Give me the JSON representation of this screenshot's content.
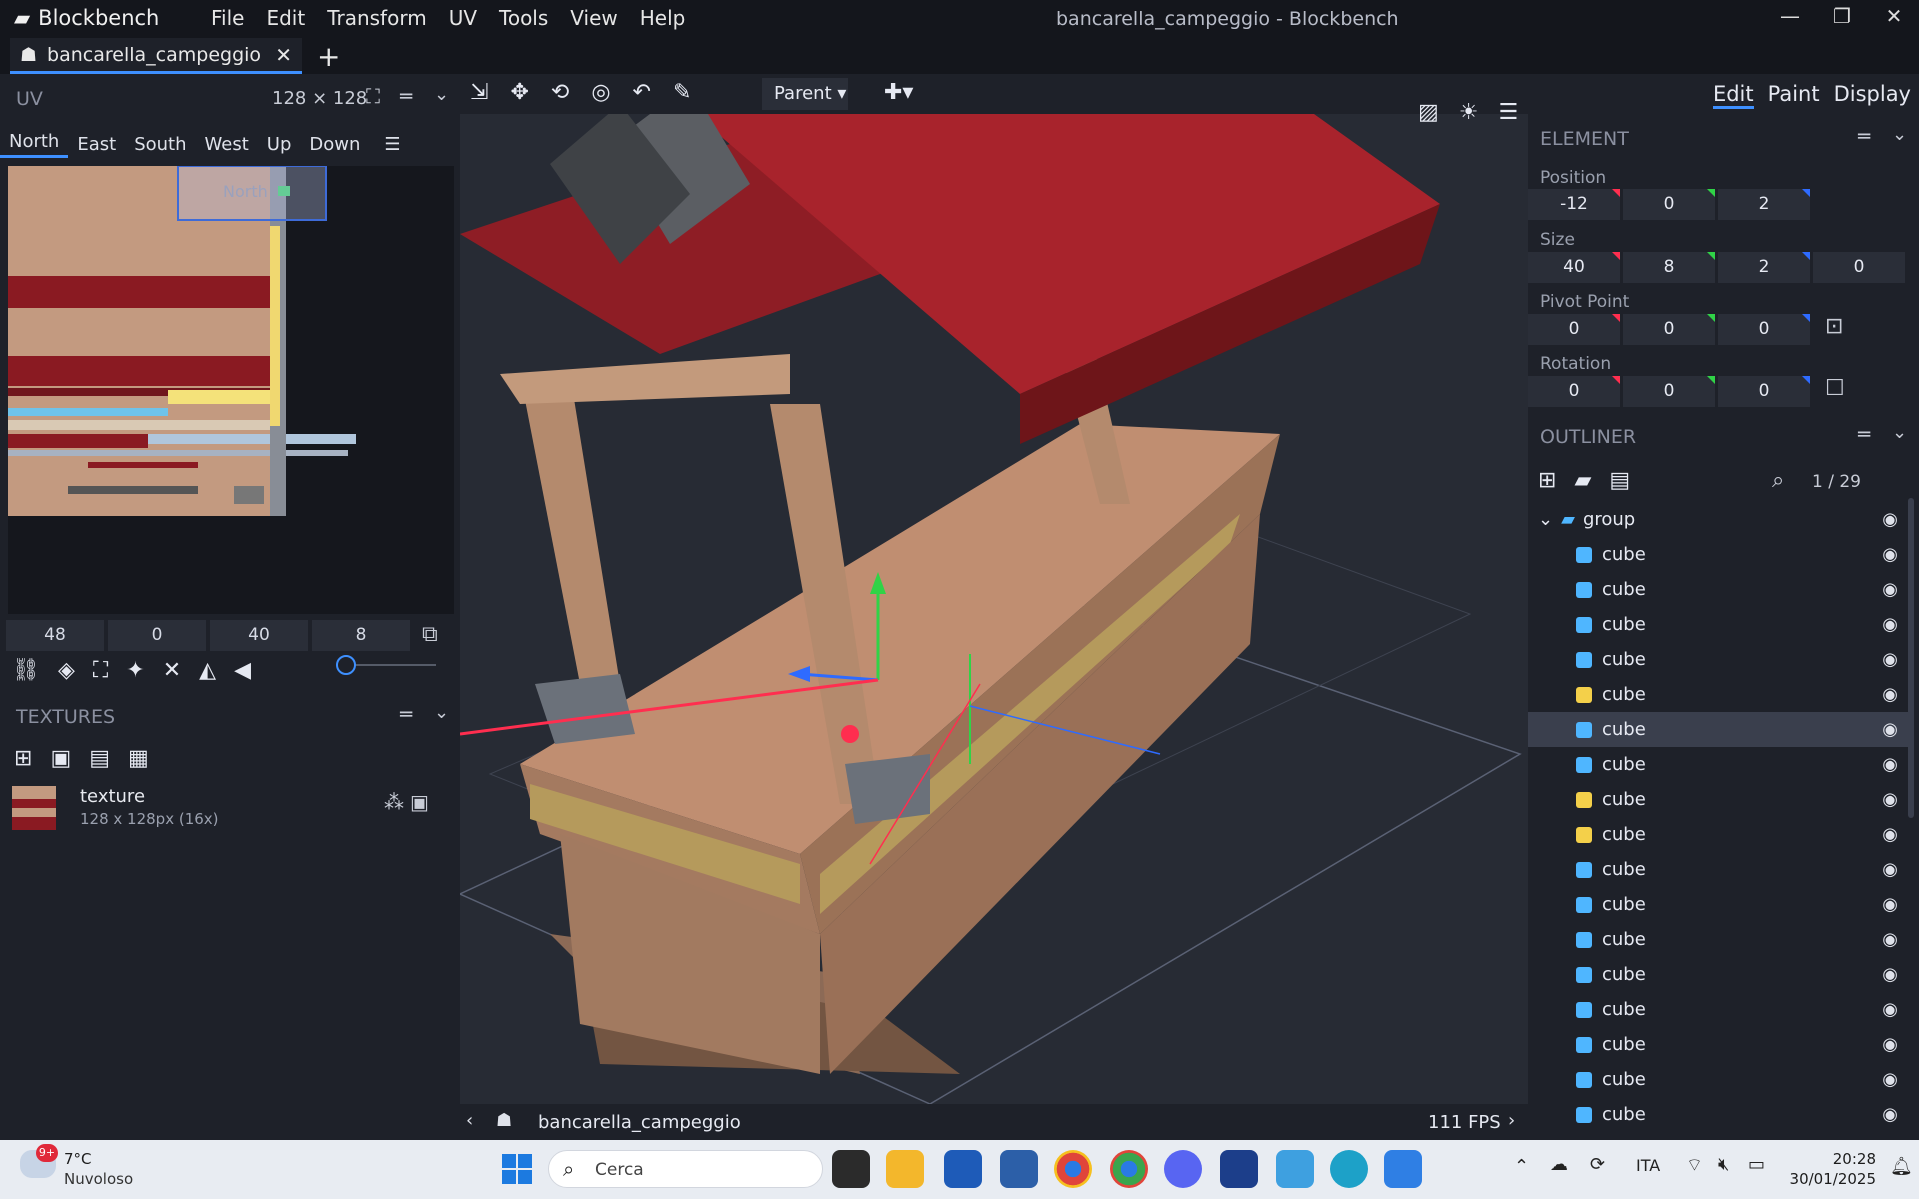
{
  "app": {
    "name": "Blockbench",
    "window_title": "bancarella_campeggio - Blockbench",
    "menu": [
      "File",
      "Edit",
      "Transform",
      "UV",
      "Tools",
      "View",
      "Help"
    ]
  },
  "tab": {
    "name": "bancarella_campeggio",
    "new_tab": "+"
  },
  "uv": {
    "title": "UV",
    "resolution": "128 ⨯ 128",
    "faces": [
      "North",
      "East",
      "South",
      "West",
      "Up",
      "Down"
    ],
    "active_face": "North",
    "face_label": "North",
    "inputs": [
      "48",
      "0",
      "40",
      "8"
    ]
  },
  "textures": {
    "title": "TEXTURES",
    "items": [
      {
        "name": "texture",
        "meta": "128 x 128px (16x)"
      }
    ]
  },
  "viewport": {
    "pivot_mode": "Parent",
    "file": "bancarella_campeggio",
    "fps": "111 FPS"
  },
  "modes": [
    "Edit",
    "Paint",
    "Display"
  ],
  "element": {
    "title": "ELEMENT",
    "position": {
      "label": "Position",
      "values": [
        "-12",
        "0",
        "2"
      ]
    },
    "size": {
      "label": "Size",
      "values": [
        "40",
        "8",
        "2",
        "0"
      ]
    },
    "pivot": {
      "label": "Pivot Point",
      "values": [
        "0",
        "0",
        "0"
      ]
    },
    "rotation": {
      "label": "Rotation",
      "values": [
        "0",
        "0",
        "0"
      ]
    }
  },
  "outliner": {
    "title": "OUTLINER",
    "count": "1 / 29",
    "group": "group",
    "items": [
      "cube",
      "cube",
      "cube",
      "cube",
      "cube",
      "cube",
      "cube",
      "cube",
      "cube",
      "cube",
      "cube",
      "cube",
      "cube",
      "cube",
      "cube",
      "cube",
      "cube"
    ],
    "selected_index": 5
  },
  "axis_colors": {
    "x": "#ff2e4f",
    "y": "#30d347",
    "z": "#2e6bff"
  },
  "taskbar": {
    "weather_temp": "7°C",
    "weather_desc": "Nuvoloso",
    "weather_badge": "9+",
    "search": "Cerca",
    "lang": "ITA",
    "time": "20:28",
    "date": "30/01/2025"
  }
}
